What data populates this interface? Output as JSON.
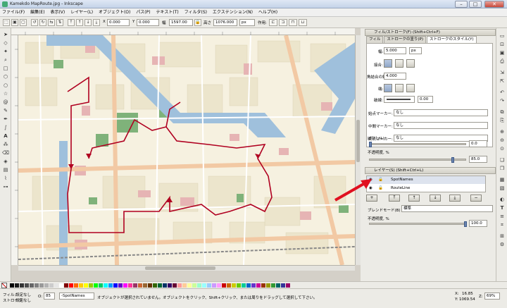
{
  "window": {
    "title": "Kamekdo MapRoute.jpg - Inkscape"
  },
  "menu": [
    "ファイル(F)",
    "編集(E)",
    "表示(V)",
    "レイヤー(L)",
    "オブジェクト(O)",
    "パス(P)",
    "テキスト(T)",
    "フィルタ(S)",
    "エクステンション(N)",
    "ヘルプ(H)"
  ],
  "toolctrl": {
    "x_label": "X",
    "x_value": "0.000",
    "y_label": "Y",
    "y_value": "0.000",
    "w_label": "幅",
    "w_value": "1597.00",
    "h_label": "高さ",
    "h_value": "1076.000",
    "unit": "px",
    "affect_label": "作用:"
  },
  "left_tools": [
    "select-icon",
    "node-icon",
    "tweak-icon",
    "zoom-icon",
    "rect-icon",
    "3dbox-icon",
    "ellipse-icon",
    "star-icon",
    "spiral-icon",
    "pencil-icon",
    "pen-icon",
    "calligraphy-icon",
    "text-icon",
    "spray-icon",
    "eraser-icon",
    "bucket-icon",
    "gradient-icon",
    "dropper-icon",
    "connector-icon"
  ],
  "fill_stroke": {
    "header": "フィル/ストローク(F) (Shift+Ctrl+F)",
    "tabs": [
      "フィル",
      "ストロークの塗り(P)",
      "ストロークのスタイル(Y)"
    ],
    "width_label": "幅:",
    "width_value": "5.000",
    "width_unit": "px",
    "join_label": "接合:",
    "miter_label": "角結合の鋭角:",
    "miter_value": "4.000",
    "cap_label": "端:",
    "dash_label": "破線:",
    "dash_value": "0.00",
    "start_marker_label": "始点マーカー:",
    "start_marker_value": "なし",
    "mid_marker_label": "中間マーカー:",
    "mid_marker_value": "なし",
    "end_marker_label": "終点マーカー:",
    "end_marker_value": "なし",
    "blur_label": "ぼかし(L):",
    "blur_value": "0.0",
    "opacity_label": "不透明度, %",
    "opacity_value": "85.0"
  },
  "layers_panel": {
    "header": "レイヤー(S) (Shift+Ctrl+L)",
    "layers": [
      {
        "name": "SpotNames"
      },
      {
        "name": "RouteLine"
      }
    ],
    "blend_label": "ブレンドモード(B)",
    "blend_value": "標準",
    "opacity_label": "不透明度, %",
    "opacity_value": "100.0"
  },
  "palette_colors": [
    "#000000",
    "#1a1a1a",
    "#333333",
    "#4d4d4d",
    "#666666",
    "#808080",
    "#999999",
    "#b3b3b3",
    "#cccccc",
    "#e6e6e6",
    "#ffffff",
    "#800000",
    "#ff0000",
    "#ff6600",
    "#ffcc00",
    "#ffff00",
    "#99cc00",
    "#00ff00",
    "#00cc66",
    "#00ffff",
    "#0099ff",
    "#0000ff",
    "#6600cc",
    "#ff00ff",
    "#ff3399",
    "#993366",
    "#cc6633",
    "#996633",
    "#663300",
    "#336600",
    "#006633",
    "#003366",
    "#330066",
    "#660033",
    "#ff9999",
    "#ffcc99",
    "#ffff99",
    "#ccff99",
    "#99ffcc",
    "#99ffff",
    "#99ccff",
    "#cc99ff",
    "#ff99ff",
    "#cc0000",
    "#cc6600",
    "#cccc00",
    "#66cc00",
    "#00cc99",
    "#0066cc",
    "#6633cc",
    "#cc0099",
    "#993300",
    "#999900",
    "#339933",
    "#006666",
    "#333399",
    "#990066"
  ],
  "status": {
    "fill_label": "フィル:",
    "fill_value": "設定なし",
    "stroke_label": "ストローク:",
    "stroke_value": "設定なし",
    "o_label": "O:",
    "o_value": "85",
    "layer_value": "-SpotNames",
    "message": "オブジェクトが選択されていません。オブジェクトをクリック、Shift+クリック、または周りをドラッグして選択して下さい。",
    "x_label": "X:",
    "x_value": "16.85",
    "y_label": "Y:",
    "y_value": "1069.54",
    "z_label": "Z:",
    "zoom_value": "69%"
  }
}
